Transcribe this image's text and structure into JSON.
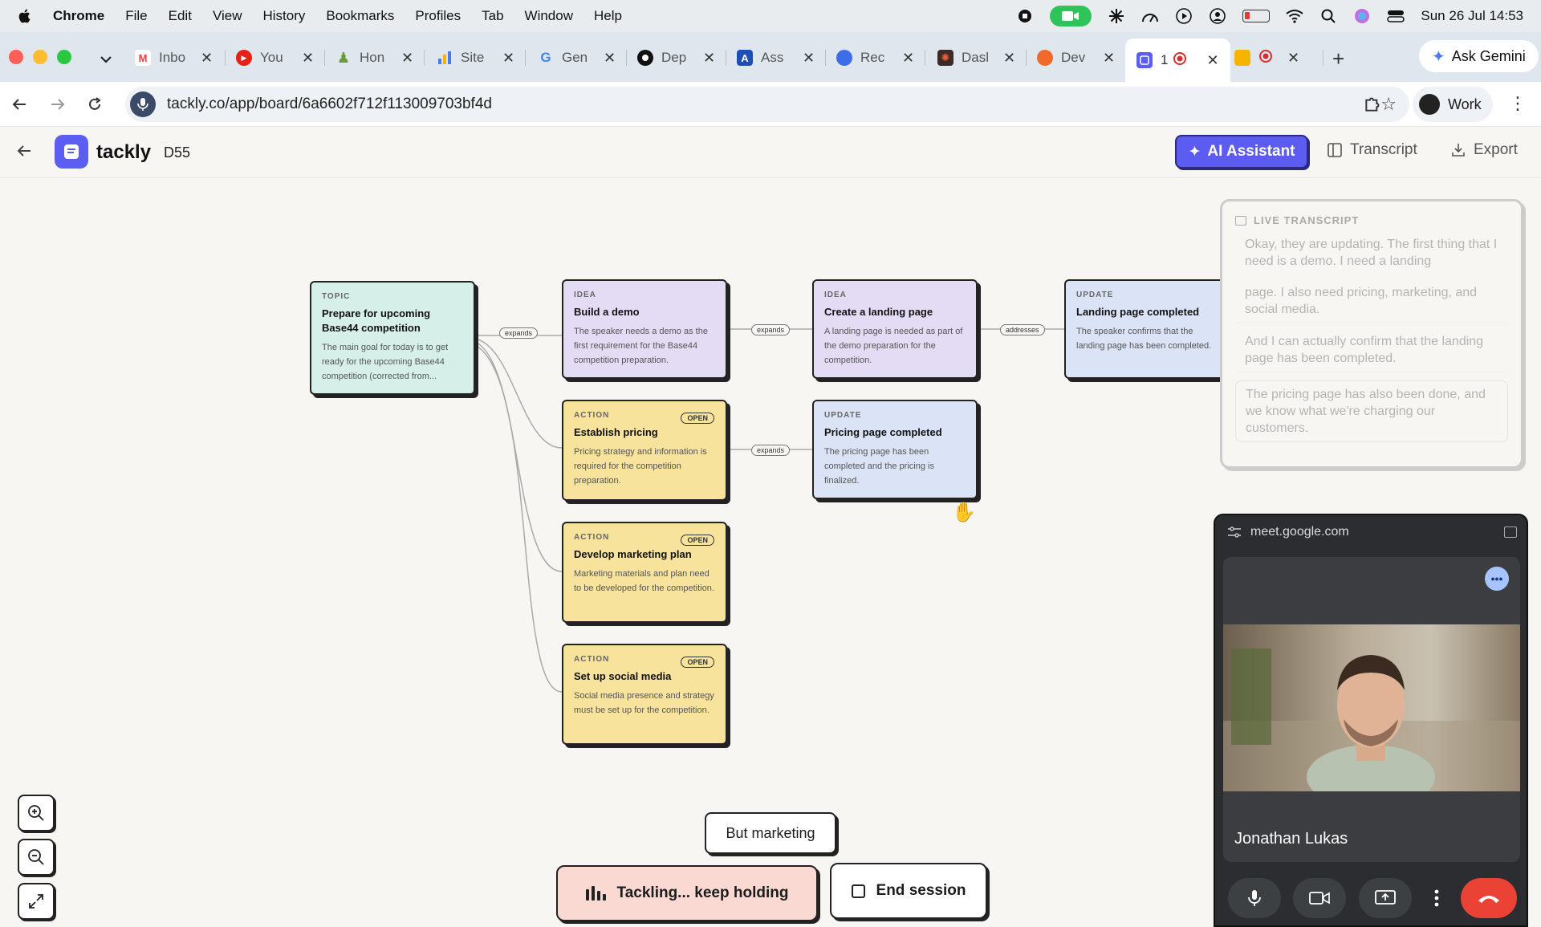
{
  "menubar": {
    "app": "Chrome",
    "items": [
      "File",
      "Edit",
      "View",
      "History",
      "Bookmarks",
      "Profiles",
      "Tab",
      "Window",
      "Help"
    ],
    "clock": "Sun 26 Jul  14:53"
  },
  "tabs": [
    {
      "label": "Inbo",
      "icon": "gmail-icon",
      "color": "#ea4335",
      "glyph": "M"
    },
    {
      "label": "You",
      "icon": "youtube-icon",
      "color": "#e62117",
      "glyph": "▶"
    },
    {
      "label": "Hon",
      "icon": "chess-icon",
      "color": "#6a9a3a",
      "glyph": "♟"
    },
    {
      "label": "Site",
      "icon": "analytics-icon",
      "color": "#4a7cf0",
      "glyph": "▮"
    },
    {
      "label": "Gen",
      "icon": "google-icon",
      "color": "#4285f4",
      "glyph": "G"
    },
    {
      "label": "Dep",
      "icon": "github-icon",
      "color": "#111111",
      "glyph": "●"
    },
    {
      "label": "Ass",
      "icon": "atlassian-icon",
      "color": "#1e4fb8",
      "glyph": "A"
    },
    {
      "label": "Rec",
      "icon": "record-icon",
      "color": "#3d6ee8",
      "glyph": "●"
    },
    {
      "label": "Dasl",
      "icon": "dashboard-icon",
      "color": "#b23a2a",
      "glyph": "✺"
    },
    {
      "label": "Dev",
      "icon": "dev-icon",
      "color": "#f06a2a",
      "glyph": "●"
    },
    {
      "label": "1",
      "icon": "tackly-icon",
      "color": "#5b5ef0",
      "glyph": "▤"
    },
    {
      "label": "",
      "icon": "meet-icon",
      "color": "#f5b400",
      "glyph": "▶"
    }
  ],
  "ask_gemini": "Ask Gemini",
  "address": {
    "url": "tackly.co/app/board/6a6602f712f113009703bf4d",
    "profile_label": "Work"
  },
  "app": {
    "brand": "tackly",
    "board_name": "D55",
    "ai_button": "AI Assistant",
    "transcript_link": "Transcript",
    "export_link": "Export"
  },
  "nodes": {
    "topic": {
      "type": "TOPIC",
      "title": "Prepare for upcoming Base44 competition",
      "desc": "The main goal for today is to get ready for the upcoming Base44 competition (corrected from..."
    },
    "idea_demo": {
      "type": "IDEA",
      "title": "Build a demo",
      "desc": "The speaker needs a demo as the first requirement for the Base44 competition preparation."
    },
    "idea_landing": {
      "type": "IDEA",
      "title": "Create a landing page",
      "desc": "A landing page is needed as part of the demo preparation for the competition."
    },
    "update_landing": {
      "type": "UPDATE",
      "title": "Landing page completed",
      "desc": "The speaker confirms that the landing page has been completed."
    },
    "action_pricing": {
      "type": "ACTION",
      "badge": "OPEN",
      "title": "Establish pricing",
      "desc": "Pricing strategy and information is required for the competition preparation."
    },
    "update_pricing": {
      "type": "UPDATE",
      "title": "Pricing page completed",
      "desc": "The pricing page has been completed and the pricing is finalized."
    },
    "action_marketing": {
      "type": "ACTION",
      "badge": "OPEN",
      "title": "Develop marketing plan",
      "desc": "Marketing materials and plan need to be developed for the competition."
    },
    "action_social": {
      "type": "ACTION",
      "badge": "OPEN",
      "title": "Set up social media",
      "desc": "Social media presence and strategy must be set up for the competition."
    }
  },
  "edges": {
    "e1": "expands",
    "e2": "expands",
    "e3": "addresses",
    "e4": "expands"
  },
  "transcript": {
    "heading": "LIVE TRANSCRIPT",
    "lines": [
      "Okay, they are updating. The first thing that I need is a demo. I need a landing",
      "page. I also need pricing, marketing, and social media.",
      "And I can actually confirm that the landing page has been completed.",
      "The pricing page has also been done, and we know what we're charging our customers."
    ]
  },
  "meet": {
    "domain": "meet.google.com",
    "participant": "Jonathan Lukas"
  },
  "caption": "But marketing",
  "tackling_button": "Tackling... keep holding",
  "end_session_button": "End session",
  "colors": {
    "accent": "#5c5cf2",
    "topic": "#d6efe8",
    "idea": "#e3dcf4",
    "action": "#f7e39c",
    "update": "#dbe4f6",
    "end_call": "#ea4335"
  }
}
